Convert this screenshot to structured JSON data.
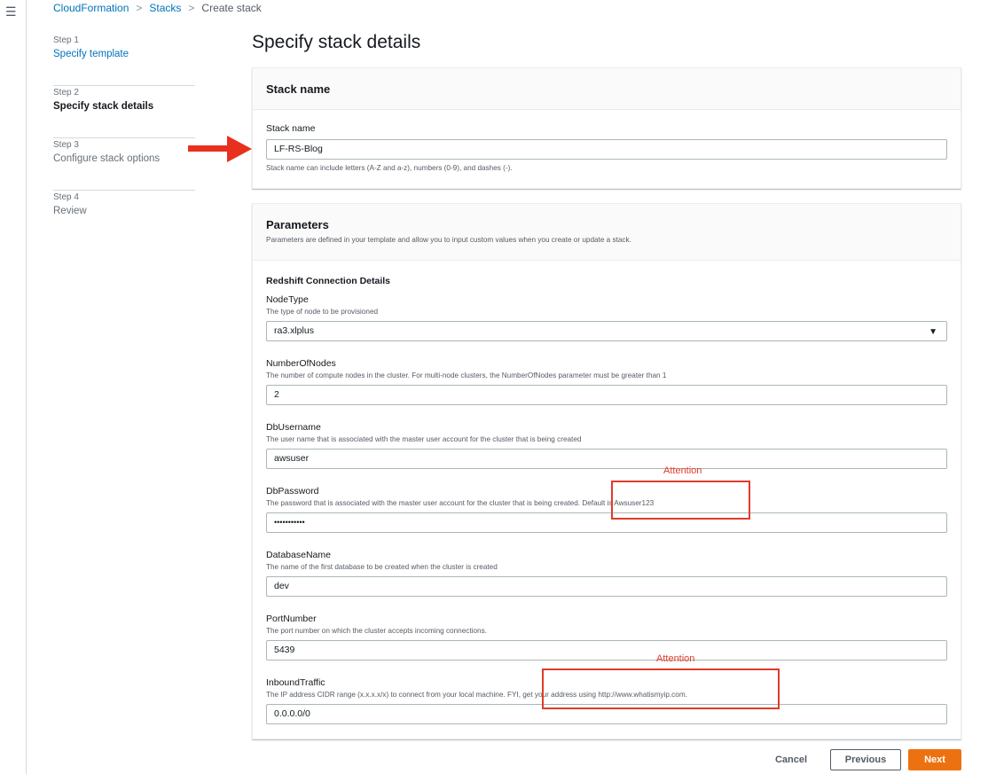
{
  "menu_icon": "hamburger-menu-icon",
  "breadcrumb": {
    "items": [
      "CloudFormation",
      "Stacks",
      "Create stack"
    ],
    "separator": ">"
  },
  "steps": [
    {
      "num": "Step 1",
      "title": "Specify template",
      "state": "link"
    },
    {
      "num": "Step 2",
      "title": "Specify stack details",
      "state": "active"
    },
    {
      "num": "Step 3",
      "title": "Configure stack options",
      "state": "disabled"
    },
    {
      "num": "Step 4",
      "title": "Review",
      "state": "disabled"
    }
  ],
  "page_title": "Specify stack details",
  "stack_name_panel": {
    "title": "Stack name",
    "field_label": "Stack name",
    "value": "LF-RS-Blog",
    "hint": "Stack name can include letters (A-Z and a-z), numbers (0-9), and dashes (-)."
  },
  "parameters_panel": {
    "title": "Parameters",
    "description": "Parameters are defined in your template and allow you to input custom values when you create or update a stack.",
    "section_title": "Redshift Connection Details",
    "fields": {
      "node_type": {
        "label": "NodeType",
        "desc": "The type of node to be provisioned",
        "value": "ra3.xlplus",
        "caret": "▼"
      },
      "number_of_nodes": {
        "label": "NumberOfNodes",
        "desc": "The number of compute nodes in the cluster. For multi-node clusters, the NumberOfNodes parameter must be greater than 1",
        "value": "2"
      },
      "db_username": {
        "label": "DbUsername",
        "desc": "The user name that is associated with the master user account for the cluster that is being created",
        "value": "awsuser"
      },
      "db_password": {
        "label": "DbPassword",
        "desc": "The password that is associated with the master user account for the cluster that is being created. Default is Awsuser123",
        "value": "•••••••••••"
      },
      "database_name": {
        "label": "DatabaseName",
        "desc": "The name of the first database to be created when the cluster is created",
        "value": "dev"
      },
      "port_number": {
        "label": "PortNumber",
        "desc": "The port number on which the cluster accepts incoming connections.",
        "value": "5439"
      },
      "inbound_traffic": {
        "label": "InboundTraffic",
        "desc": "The IP address CIDR range (x.x.x.x/x) to connect from your local machine. FYI, get your address using http://www.whatismyip.com.",
        "value": "0.0.0.0/0"
      }
    }
  },
  "annotations": {
    "attention_1": "Attention",
    "attention_2": "Attention",
    "arrow_color": "#e8301f",
    "box_color": "#e03b2b"
  },
  "footer": {
    "cancel": "Cancel",
    "previous": "Previous",
    "next": "Next"
  },
  "colors": {
    "link": "#0073bb",
    "primary_button": "#ec7211"
  }
}
